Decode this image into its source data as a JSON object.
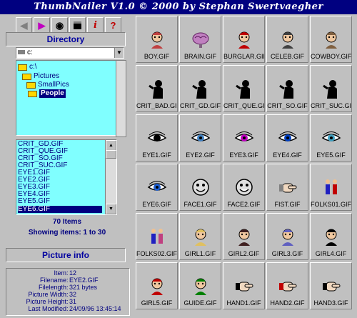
{
  "title": "ThumbNailer V1.0  ©  2000 by Stephan Swertvaegher",
  "toolbar": [
    "back-arrow",
    "forward-arrow",
    "view-eye",
    "save-disk",
    "info-i",
    "help-question"
  ],
  "directory": {
    "label": "Directory",
    "drive": "c:",
    "tree": [
      {
        "label": "c:\\",
        "depth": 0
      },
      {
        "label": "Pictures",
        "depth": 1
      },
      {
        "label": "SmallPics",
        "depth": 2
      },
      {
        "label": "People",
        "depth": 3,
        "selected": true
      }
    ]
  },
  "files": {
    "items": [
      "CRIT_GD.GIF",
      "CRIT_QUE.GIF",
      "CRIT_SO.GIF",
      "CRIT_SUC.GIF",
      "EYE1.GIF",
      "EYE2.GIF",
      "EYE3.GIF",
      "EYE4.GIF",
      "EYE5.GIF",
      "EYE6.GIF"
    ],
    "selected_index": 9,
    "total": "70 Items",
    "showing": "Showing items: 1 to 30"
  },
  "picture_info": {
    "label": "Picture info",
    "rows": [
      {
        "key": "Item",
        "value": "12"
      },
      {
        "key": "Filename",
        "value": "EYE2.GIF"
      },
      {
        "key": "Filelength",
        "value": "321 bytes"
      },
      {
        "key": "Picture Width",
        "value": "32"
      },
      {
        "key": "Picture Height",
        "value": "31"
      },
      {
        "key": "Last Modified",
        "value": "24/09/96 13:45:14"
      }
    ]
  },
  "thumbnails": [
    {
      "name": "BOY.GIF",
      "icon": "boy-face",
      "color": "#c04040"
    },
    {
      "name": "BRAIN.GIF",
      "icon": "brain",
      "color": "#c080c0"
    },
    {
      "name": "BURGLAR.GIF",
      "icon": "burglar-mask",
      "color": "#c00000"
    },
    {
      "name": "CELEB.GIF",
      "icon": "celeb-sunglasses",
      "color": "#404040"
    },
    {
      "name": "COWBOY.GIF",
      "icon": "cowboy-hat",
      "color": "#806040"
    },
    {
      "name": "CRIT_BAD.GIF",
      "icon": "critic-silhouette",
      "color": "#000000"
    },
    {
      "name": "CRIT_GD.GIF",
      "icon": "critic-silhouette",
      "color": "#000000"
    },
    {
      "name": "CRIT_QUE.GIF",
      "icon": "critic-silhouette",
      "color": "#000000"
    },
    {
      "name": "CRIT_SO.GIF",
      "icon": "critic-silhouette",
      "color": "#000000"
    },
    {
      "name": "CRIT_SUC.GIF",
      "icon": "critic-silhouette",
      "color": "#000000"
    },
    {
      "name": "EYE1.GIF",
      "icon": "eye",
      "color": "#000000"
    },
    {
      "name": "EYE2.GIF",
      "icon": "eye",
      "color": "#4080c0"
    },
    {
      "name": "EYE3.GIF",
      "icon": "eye-rainbow",
      "color": "#c000c0"
    },
    {
      "name": "EYE4.GIF",
      "icon": "eye",
      "color": "#0040c0"
    },
    {
      "name": "EYE5.GIF",
      "icon": "eye",
      "color": "#40a0c0"
    },
    {
      "name": "EYE6.GIF",
      "icon": "eye",
      "color": "#2060d0"
    },
    {
      "name": "FACE1.GIF",
      "icon": "smiley-face",
      "color": "#000000"
    },
    {
      "name": "FACE2.GIF",
      "icon": "grin-face",
      "color": "#000000"
    },
    {
      "name": "FIST.GIF",
      "icon": "fist",
      "color": "#808080"
    },
    {
      "name": "FOLKS01.GIF",
      "icon": "two-people",
      "color": "#c00000"
    },
    {
      "name": "FOLKS02.GIF",
      "icon": "group-people",
      "color": "#c04080"
    },
    {
      "name": "GIRL1.GIF",
      "icon": "girl-blonde",
      "color": "#e0c060"
    },
    {
      "name": "GIRL2.GIF",
      "icon": "girl-dark",
      "color": "#402020"
    },
    {
      "name": "GIRL3.GIF",
      "icon": "girl-hat",
      "color": "#6060c0"
    },
    {
      "name": "GIRL4.GIF",
      "icon": "girl-black-hair",
      "color": "#000000"
    },
    {
      "name": "GIRL5.GIF",
      "icon": "girl-red-hair",
      "color": "#c00000"
    },
    {
      "name": "GUIDE.GIF",
      "icon": "guide",
      "color": "#008000"
    },
    {
      "name": "HAND1.GIF",
      "icon": "hand-open",
      "color": "#000000"
    },
    {
      "name": "HAND2.GIF",
      "icon": "hand-point",
      "color": "#c00000"
    },
    {
      "name": "HAND3.GIF",
      "icon": "hand-point-right",
      "color": "#000000"
    }
  ]
}
